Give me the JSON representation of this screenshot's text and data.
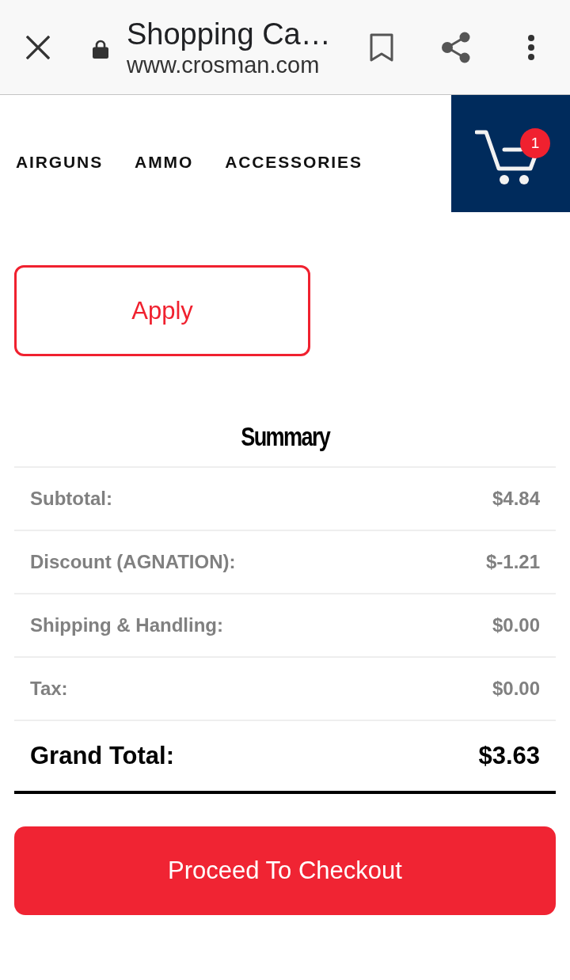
{
  "browser_bar": {
    "title": "Shopping Ca…",
    "url": "www.crosman.com"
  },
  "nav": {
    "items": [
      "AIRGUNS",
      "AMMO",
      "ACCESSORIES"
    ],
    "cart_count": "1"
  },
  "coupon": {
    "button": "Apply"
  },
  "summary": {
    "title": "Summary",
    "rows": [
      {
        "label": "Subtotal:",
        "value": "$4.84"
      },
      {
        "label": "Discount (AGNATION):",
        "value": "$-1.21"
      },
      {
        "label": "Shipping & Handling:",
        "value": "$0.00"
      },
      {
        "label": "Tax:",
        "value": "$0.00"
      }
    ],
    "grand_total": {
      "label": "Grand Total:",
      "value": "$3.63"
    }
  },
  "checkout_button": "Proceed To Checkout"
}
